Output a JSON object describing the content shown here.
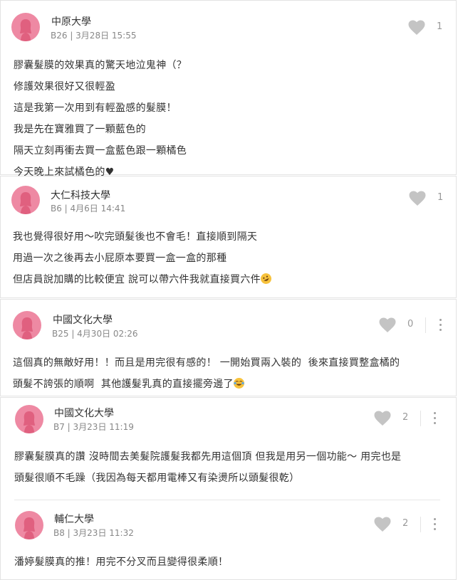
{
  "comments": [
    {
      "school": "中原大學",
      "floor_time": "B26 | 3月28日 15:55",
      "likes": "1",
      "lines": [
        "膠囊髮膜的效果真的驚天地泣鬼神（？",
        "修護效果很好又很輕盈",
        "這是我第一次用到有輕盈感的髮膜！",
        "我是先在寶雅買了一顆藍色的",
        "隔天立刻再衝去買一盒藍色跟一顆橘色",
        "今天晚上來試橘色的♥"
      ]
    },
    {
      "school": "大仁科技大學",
      "floor_time": "B6 | 4月6日 14:41",
      "likes": "1",
      "lines": [
        "我也覺得很好用～吹完頭髮後也不會毛！直接順到隔天",
        "用過一次之後再去小屁原本要買一盒一盒的那種",
        "但店員說加購的比較便宜 說可以帶六件我就直接買六件"
      ]
    },
    {
      "school": "中國文化大學",
      "floor_time": "B25 | 4月30日 02:26",
      "likes": "0",
      "lines": [
        "這個真的無敵好用！！而且是用完很有感的！ 一開始買兩入裝的  後來直接買整盒橘的",
        "頭髮不誇張的順啊  其他護髮乳真的直接擺旁邊了"
      ]
    },
    {
      "school": "中國文化大學",
      "floor_time": "B7 | 3月23日 11:19",
      "likes": "2",
      "lines": [
        "膠囊髮膜真的讚 沒時間去美髮院護髮我都先用這個頂 但我是用另一個功能～ 用完也是",
        "頭髮很順不毛躁（我因為每天都用電棒又有染燙所以頭髮很乾）"
      ]
    },
    {
      "school": "輔仁大學",
      "floor_time": "B8 | 3月23日 11:32",
      "likes": "2",
      "lines": [
        "潘婷髮膜真的推！用完不分叉而且變得很柔順！"
      ]
    }
  ],
  "icons": {
    "like": "heart-icon",
    "more": "more-vertical-icon",
    "avatar": "female-avatar-icon",
    "emoji_laugh": "rofl-emoji-icon",
    "emoji_tears": "tears-of-joy-emoji-icon"
  },
  "colors": {
    "avatar_bg": "#ee89a3",
    "avatar_figure": "#e0607f",
    "heart": "#c4c4c4",
    "text": "#333333",
    "meta": "#888888"
  }
}
